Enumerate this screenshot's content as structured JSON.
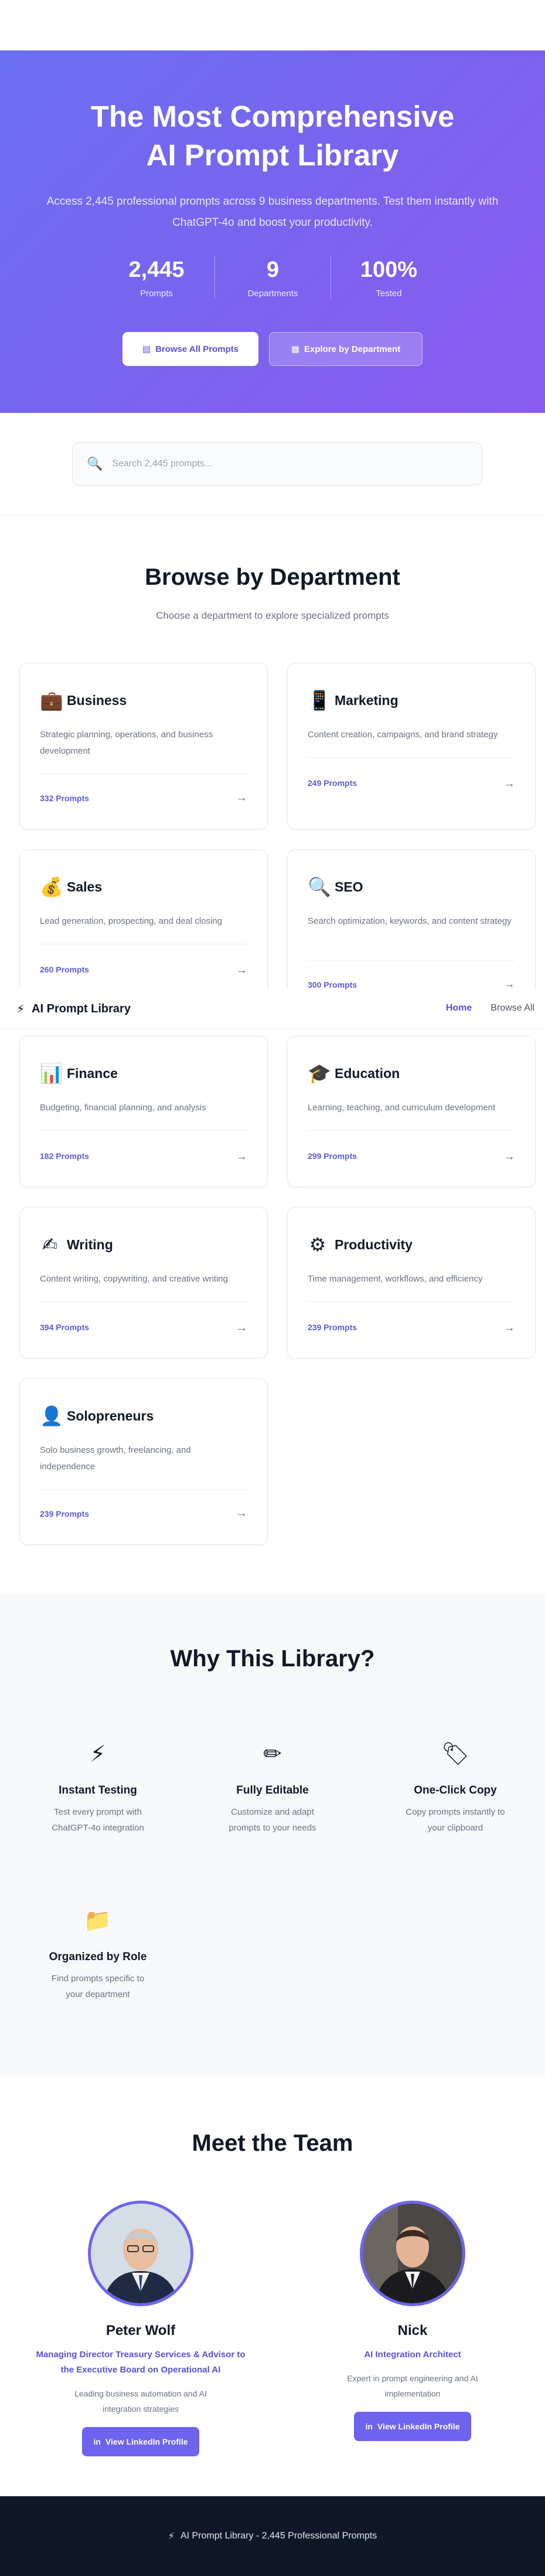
{
  "hero": {
    "title_line1": "The Most Comprehensive",
    "title_line2": "AI Prompt Library",
    "subtitle_line1": "Access 2,445 professional prompts across 9 business departments. Test them instantly with",
    "subtitle_line2": "ChatGPT-4o and boost your productivity.",
    "stats": [
      {
        "value": "2,445",
        "label": "Prompts"
      },
      {
        "value": "9",
        "label": "Departments"
      },
      {
        "value": "100%",
        "label": "Tested"
      }
    ],
    "browse_all_label": "Browse All Prompts",
    "explore_label": "Explore by Department"
  },
  "search": {
    "placeholder": "Search 2,445 prompts...",
    "icon": "magnifier-icon"
  },
  "browse": {
    "title": "Browse by Department",
    "subtitle": "Choose a department to explore specialized prompts",
    "departments": [
      {
        "name": "Business",
        "icon": "briefcase-icon",
        "desc": "Strategic planning, operations, and business development",
        "count": "332 Prompts"
      },
      {
        "name": "Marketing",
        "icon": "phone-icon",
        "desc": "Content creation, campaigns, and brand strategy",
        "count": "249 Prompts"
      },
      {
        "name": "Sales",
        "icon": "money-bag-icon",
        "desc": "Lead generation, prospecting, and deal closing",
        "count": "260 Prompts"
      },
      {
        "name": "SEO",
        "icon": "magnifier-icon",
        "desc": "Search optimization, keywords, and content strategy",
        "count": "300 Prompts"
      },
      {
        "name": "Finance",
        "icon": "chart-icon",
        "desc": "Budgeting, financial planning, and analysis",
        "count": "182 Prompts"
      },
      {
        "name": "Education",
        "icon": "graduation-cap-icon",
        "desc": "Learning, teaching, and curriculum development",
        "count": "299 Prompts"
      },
      {
        "name": "Writing",
        "icon": "writing-hand-icon",
        "desc": "Content writing, copywriting, and creative writing",
        "count": "394 Prompts"
      },
      {
        "name": "Productivity",
        "icon": "gear-icon",
        "desc": "Time management, workflows, and efficiency",
        "count": "239 Prompts"
      },
      {
        "name": "Solopreneurs",
        "icon": "person-icon",
        "desc": "Solo business growth, freelancing, and independence",
        "count": "239 Prompts"
      }
    ]
  },
  "nav": {
    "brand": "AI Prompt Library",
    "home": "Home",
    "browse_all": "Browse All"
  },
  "why": {
    "title": "Why This Library?",
    "features": [
      {
        "title": "Instant Testing",
        "desc": "Test every prompt with ChatGPT-4o integration",
        "icon": "lightning-icon"
      },
      {
        "title": "Fully Editable",
        "desc": "Customize and adapt prompts to your needs",
        "icon": "pencil-icon"
      },
      {
        "title": "One-Click Copy",
        "desc": "Copy prompts instantly to your clipboard",
        "icon": "tag-icon"
      },
      {
        "title": "Organized by Role",
        "desc": "Find prompts specific to your department",
        "icon": "folder-icon"
      }
    ]
  },
  "team": {
    "title": "Meet the Team",
    "members": [
      {
        "name": "Peter Wolf",
        "role": "Managing Director Treasury Services & Advisor to the Executive Board on Operational AI",
        "bio": "Leading business automation and AI integration strategies",
        "button": "View LinkedIn Profile"
      },
      {
        "name": "Nick",
        "role": "AI Integration Architect",
        "bio": "Expert in prompt engineering and AI implementation",
        "button": "View LinkedIn Profile"
      }
    ]
  },
  "footer": {
    "text": "AI Prompt Library - 2,445 Professional Prompts"
  },
  "colors": {
    "accent": "#5b4fd9",
    "hero_start": "#6a70ef",
    "hero_end": "#8a5cf0",
    "footer_bg": "#0f1729"
  }
}
